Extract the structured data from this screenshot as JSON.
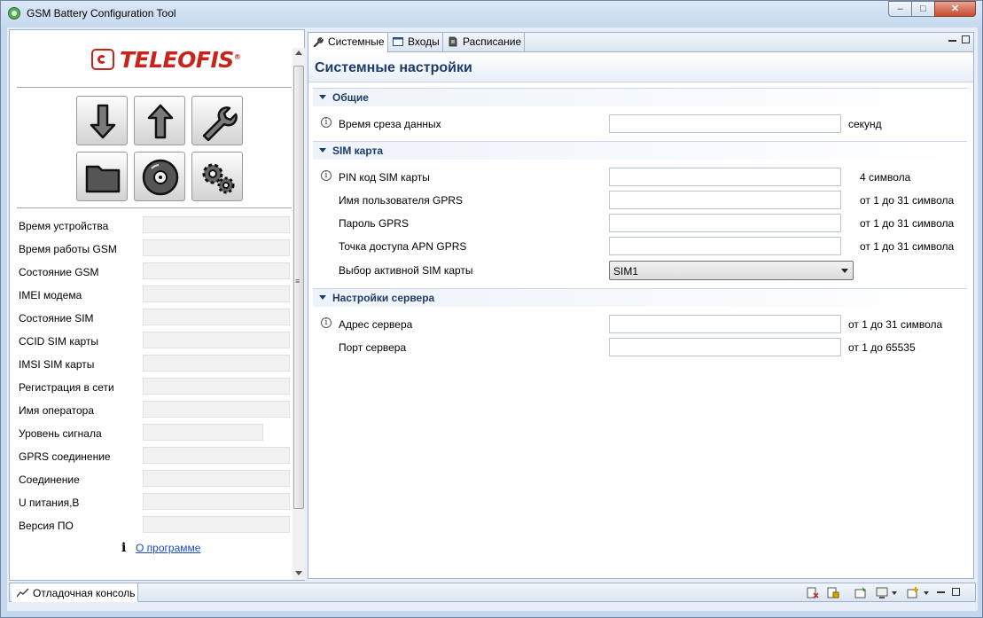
{
  "window": {
    "title": "GSM Battery Configuration Tool",
    "controls": {
      "minimize": "–",
      "maximize": "□",
      "close": "✕"
    }
  },
  "logo": {
    "text": "TELEOFIS",
    "reg": "®",
    "brand_color": "#c8241c"
  },
  "toolbar_buttons": [
    "read-arrow-down-icon",
    "write-arrow-up-icon",
    "wrench-icon",
    "folder-icon",
    "disc-icon",
    "gears-icon"
  ],
  "device_info": [
    {
      "label": "Время устройства",
      "value": ""
    },
    {
      "label": "Время работы GSM",
      "value": ""
    },
    {
      "label": "Состояние GSM",
      "value": ""
    },
    {
      "label": "IMEI модема",
      "value": ""
    },
    {
      "label": "Состояние SIM",
      "value": ""
    },
    {
      "label": "CCID SIM карты",
      "value": ""
    },
    {
      "label": "IMSI SIM карты",
      "value": ""
    },
    {
      "label": "Регистрация в сети",
      "value": ""
    },
    {
      "label": "Имя оператора",
      "value": ""
    },
    {
      "label": "Уровень сигнала",
      "value": ""
    },
    {
      "label": "GPRS соединение",
      "value": ""
    },
    {
      "label": "Соединение",
      "value": ""
    },
    {
      "label": "U питания,В",
      "value": ""
    },
    {
      "label": "Версия ПО",
      "value": ""
    }
  ],
  "about": {
    "icon": "i",
    "link": "О программе"
  },
  "tabs": [
    {
      "label": "Системные",
      "icon": "wrench-icon",
      "active": true
    },
    {
      "label": "Входы",
      "icon": "window-icon",
      "active": false
    },
    {
      "label": "Расписание",
      "icon": "schedule-icon",
      "active": false
    }
  ],
  "form": {
    "title": "Системные настройки",
    "sections": {
      "general": {
        "title": "Общие",
        "fields": [
          {
            "label": "Время среза данных",
            "value": "",
            "unit": "секунд"
          }
        ]
      },
      "sim": {
        "title": "SIM карта",
        "fields": [
          {
            "label": "PIN код SIM карты",
            "value": "",
            "unit": "4 символа"
          },
          {
            "label": "Имя пользователя GPRS",
            "value": "",
            "unit": "от 1 до 31 символа"
          },
          {
            "label": "Пароль GPRS",
            "value": "",
            "unit": "от 1 до 31 символа"
          },
          {
            "label": "Точка доступа APN GPRS",
            "value": "",
            "unit": "от 1 до 31 символа"
          }
        ],
        "select": {
          "label": "Выбор активной SIM карты",
          "value": "SIM1"
        }
      },
      "server": {
        "title": "Настройки сервера",
        "fields": [
          {
            "label": "Адрес сервера",
            "value": "",
            "unit": "от 1 до 31 символа"
          },
          {
            "label": "Порт сервера",
            "value": "",
            "unit": "от 1 до 65535"
          }
        ]
      }
    }
  },
  "console": {
    "label": "Отладочная консоль"
  },
  "colors": {
    "accent": "#1e3c6b",
    "frame": "#c4d7ec",
    "link": "#1c49c4"
  }
}
